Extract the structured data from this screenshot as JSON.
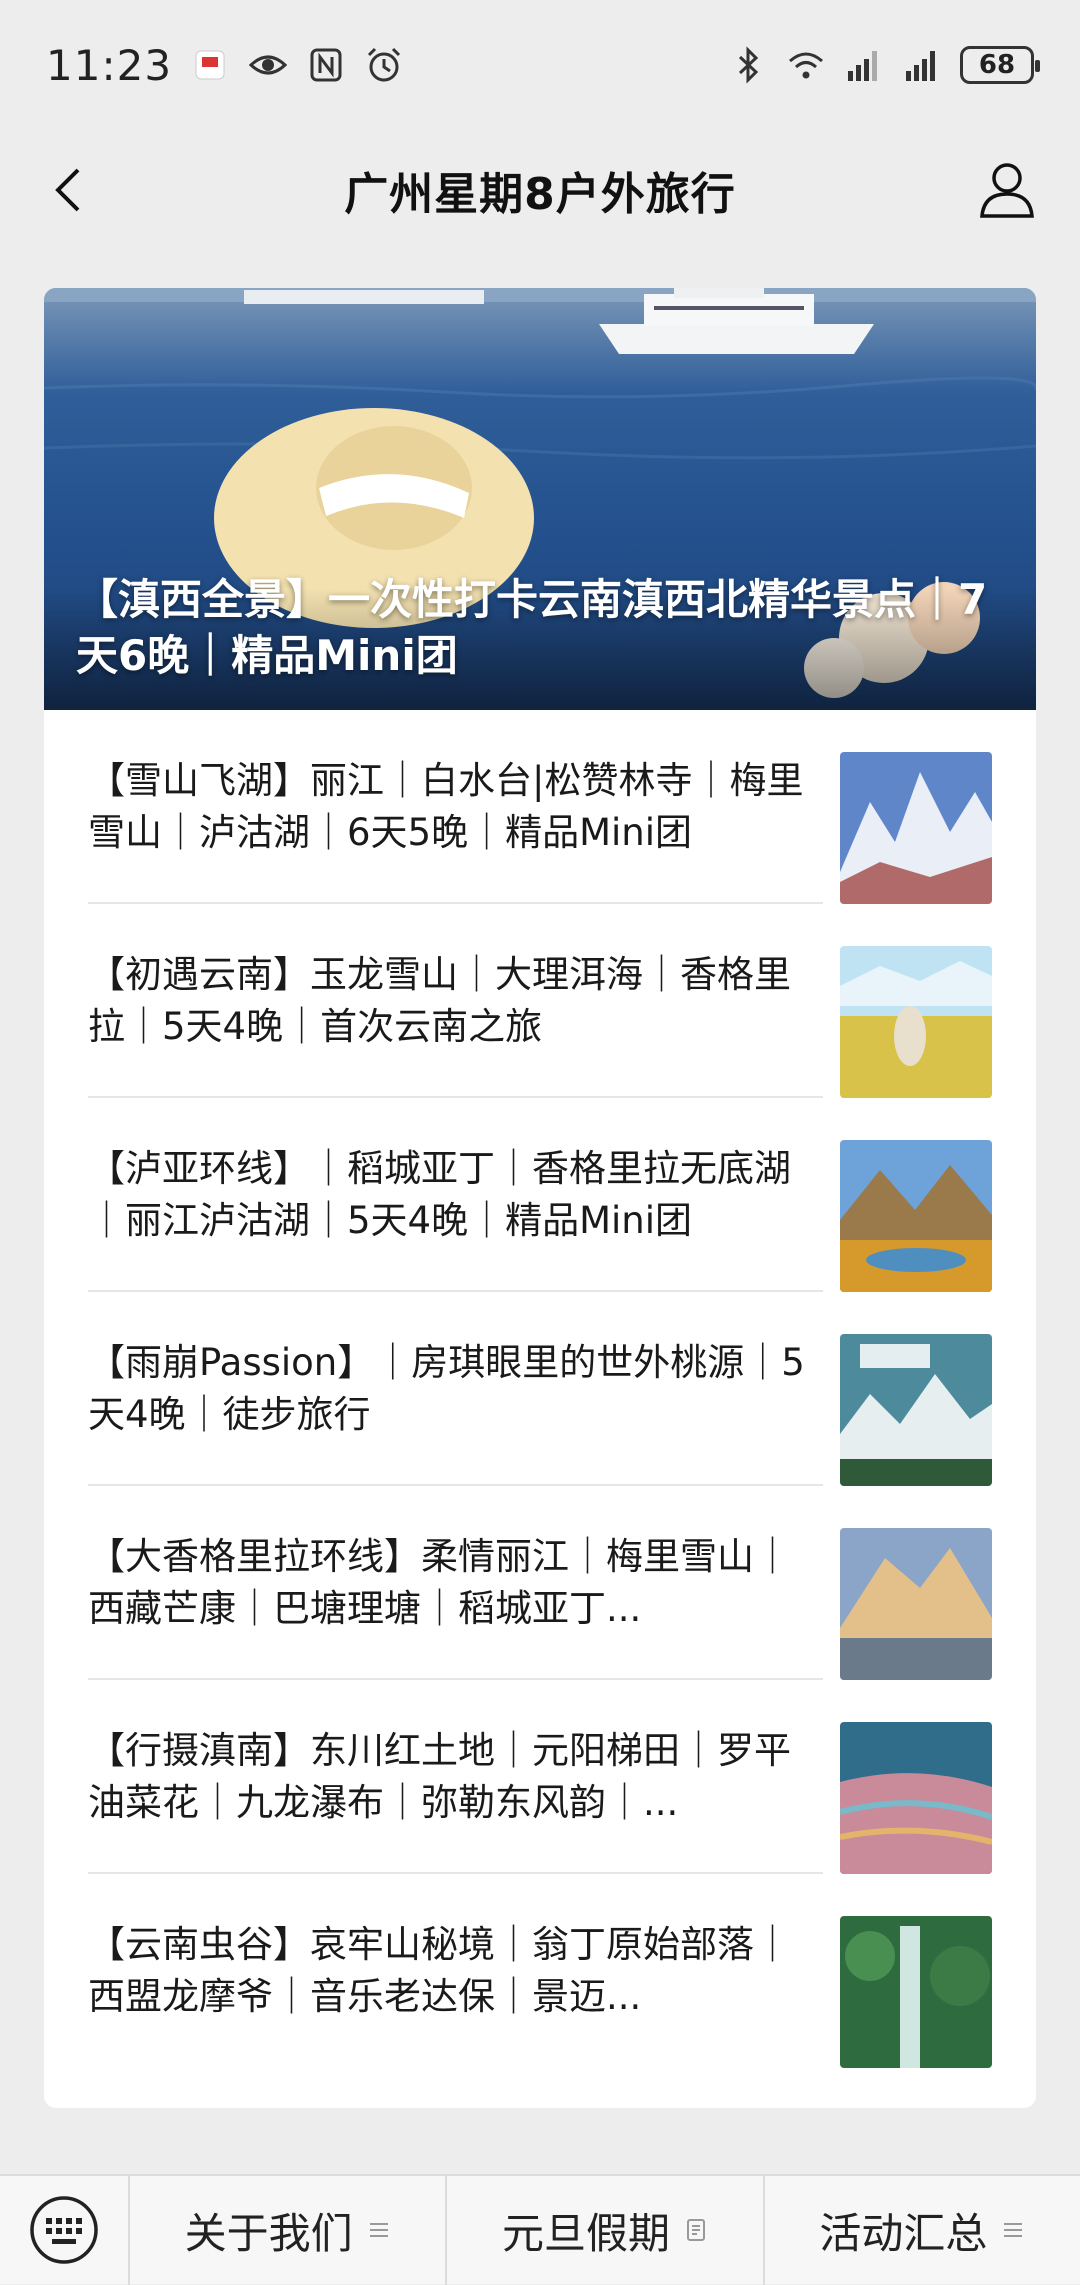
{
  "status_bar": {
    "time": "11:23",
    "battery": "68",
    "icons": [
      "notification-icon",
      "eye-icon",
      "nfc-icon",
      "alarm-icon",
      "bluetooth-icon",
      "wifi-icon",
      "signal-icon",
      "signal-icon"
    ]
  },
  "nav": {
    "title": "广州星期8户外旅行",
    "back_icon": "chevron-left-icon",
    "profile_icon": "user-icon"
  },
  "hero": {
    "title": "【滇西全景】一次性打卡云南滇西北精华景点｜7天6晚｜精品Mini团"
  },
  "articles": [
    {
      "title": "【雪山飞湖】丽江｜白水台|松赞林寺｜梅里雪山｜泸沽湖｜6天5晚｜精品Mini团"
    },
    {
      "title": "【初遇云南】玉龙雪山｜大理洱海｜香格里拉｜5天4晚｜首次云南之旅"
    },
    {
      "title": "【泸亚环线】｜稻城亚丁｜香格里拉无底湖｜丽江泸沽湖｜5天4晚｜精品Mini团"
    },
    {
      "title": "【雨崩Passion】｜房琪眼里的世外桃源｜5天4晚｜徒步旅行"
    },
    {
      "title": "【大香格里拉环线】柔情丽江｜梅里雪山｜西藏芒康｜巴塘理塘｜稻城亚丁..."
    },
    {
      "title": "【行摄滇南】东川红土地｜元阳梯田｜罗平油菜花｜九龙瀑布｜弥勒东风韵｜..."
    },
    {
      "title": "【云南虫谷】哀牢山秘境｜翁丁原始部落｜西盟龙摩爷｜音乐老达保｜景迈..."
    }
  ],
  "tabbar": {
    "keyboard_icon": "keyboard-icon",
    "tabs": [
      {
        "label": "关于我们"
      },
      {
        "label": "元旦假期"
      },
      {
        "label": "活动汇总"
      }
    ]
  }
}
